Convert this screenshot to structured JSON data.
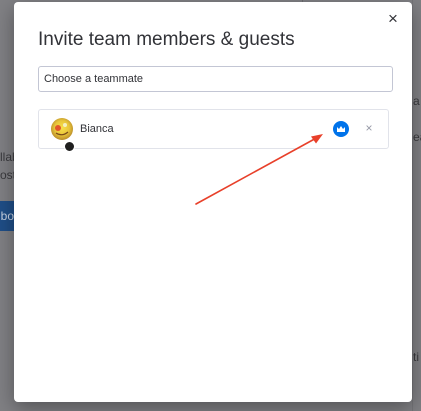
{
  "dialog": {
    "title": "Invite team members & guests",
    "close_label": "×",
    "search_placeholder": "Choose a teammate"
  },
  "members": [
    {
      "name": "Bianca",
      "owner_icon": "crown-icon",
      "remove_label": "×"
    }
  ],
  "background": {
    "left_fragments": [
      "llab",
      "oste",
      "mbo"
    ],
    "right_fragments": [
      "a",
      "ea",
      "ti"
    ]
  },
  "colors": {
    "accent": "#0073ea",
    "annotation": "#e8402a",
    "overlay": "#808084"
  }
}
